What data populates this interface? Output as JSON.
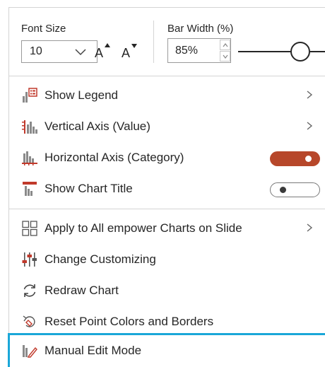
{
  "font_size": {
    "label": "Font Size",
    "value": "10",
    "grow_glyph": "A",
    "shrink_glyph": "A"
  },
  "bar_width": {
    "label": "Bar Width (%)",
    "value": "85%",
    "slider_level_percent": 85
  },
  "menu": {
    "show_legend": "Show Legend",
    "vertical_axis": "Vertical Axis (Value)",
    "horizontal_axis": "Horizontal Axis (Category)",
    "show_chart_title": "Show Chart Title",
    "apply_all": "Apply to All empower Charts on Slide",
    "change_customizing": "Change Customizing",
    "redraw_chart": "Redraw Chart",
    "reset_colors": "Reset Point Colors and Borders",
    "manual_edit": "Manual Edit Mode"
  },
  "toggles": {
    "horizontal_axis_on": true,
    "show_chart_title_on": false
  },
  "colors": {
    "accent_red": "#b7472a",
    "focus_blue": "#1aa7d8",
    "icon_red": "#c0392b",
    "icon_gray": "#8a8a8a"
  }
}
